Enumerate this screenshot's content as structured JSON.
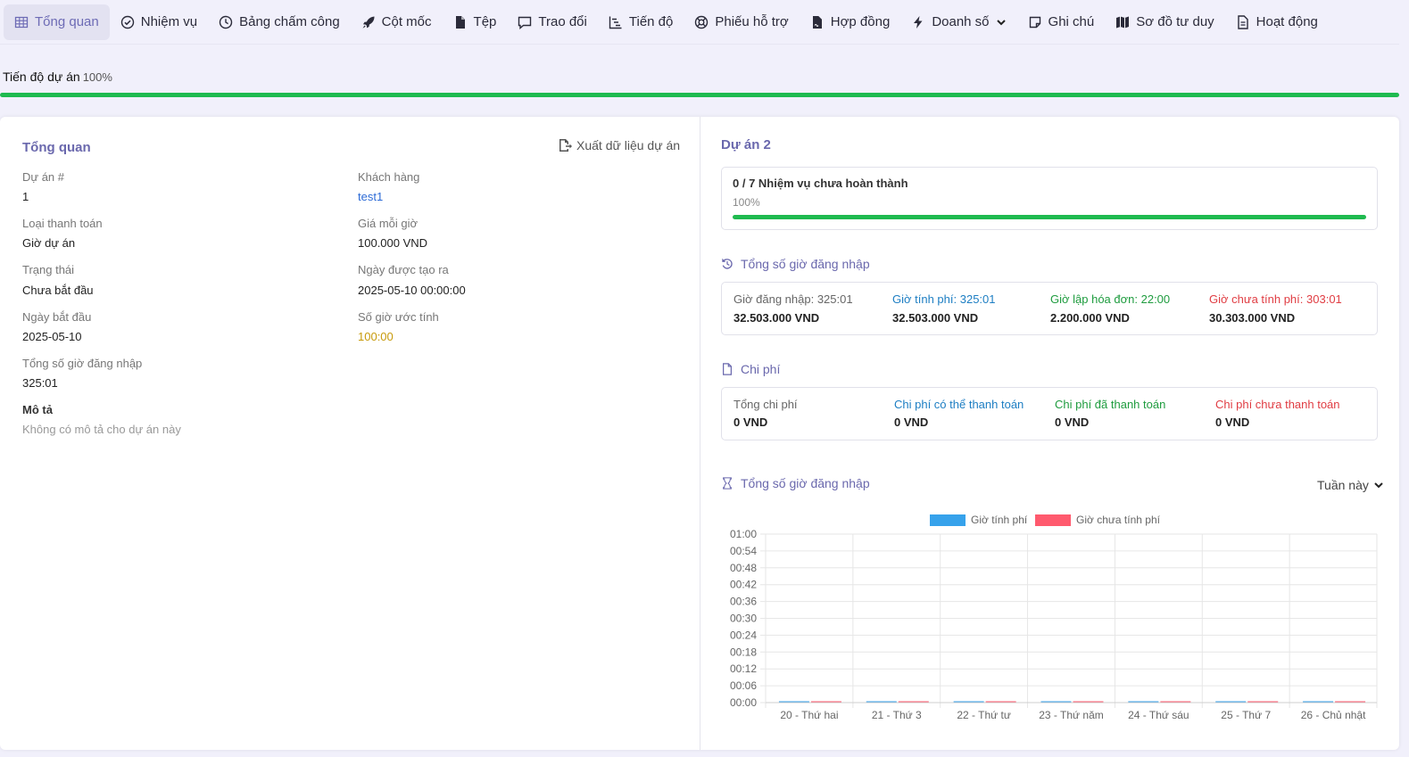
{
  "tabs": [
    {
      "label": "Tổng quan",
      "icon": "grid-icon",
      "active": true
    },
    {
      "label": "Nhiệm vụ",
      "icon": "check-circle-icon"
    },
    {
      "label": "Bảng chấm công",
      "icon": "clock-icon"
    },
    {
      "label": "Cột mốc",
      "icon": "rocket-icon"
    },
    {
      "label": "Tệp",
      "icon": "file-icon"
    },
    {
      "label": "Trao đổi",
      "icon": "chat-icon"
    },
    {
      "label": "Tiến độ",
      "icon": "gantt-icon"
    },
    {
      "label": "Phiếu hỗ trợ",
      "icon": "lifebuoy-icon"
    },
    {
      "label": "Hợp đồng",
      "icon": "contract-icon"
    },
    {
      "label": "Doanh số",
      "icon": "bolt-icon",
      "dropdown": true
    },
    {
      "label": "Ghi chú",
      "icon": "note-icon"
    },
    {
      "label": "Sơ đồ tư duy",
      "icon": "map-icon"
    },
    {
      "label": "Hoạt động",
      "icon": "document-icon"
    }
  ],
  "progress": {
    "label": "Tiến độ dự án",
    "value": "100%",
    "fraction": 1.0,
    "color": "#1fba4f"
  },
  "overview": {
    "title": "Tổng quan",
    "export_label": "Xuất dữ liệu dự án",
    "project_no_label": "Dự án #",
    "project_no": "1",
    "customer_label": "Khách hàng",
    "customer": "test1",
    "billing_type_label": "Loại thanh toán",
    "billing_type": "Giờ dự án",
    "rate_label": "Giá mỗi giờ",
    "rate": "100.000 VND",
    "status_label": "Trạng thái",
    "status": "Chưa bắt đầu",
    "created_label": "Ngày được tạo ra",
    "created": "2025-05-10 00:00:00",
    "start_label": "Ngày bắt đầu",
    "start": "2025-05-10",
    "estimate_label": "Số giờ ước tính",
    "estimate": "100:00",
    "logged_label": "Tổng số giờ đăng nhập",
    "logged": "325:01",
    "desc_label": "Mô tả",
    "desc": "Không có mô tả cho dự án này"
  },
  "right": {
    "title": "Dự án 2",
    "tasks_text": "0 / 7 Nhiệm vụ chưa hoàn thành",
    "tasks_pct": "100%",
    "tasks_fraction": 1.0,
    "hours_heading": "Tổng số giờ đăng nhập",
    "hours": [
      {
        "label": "Giờ đăng nhập: ",
        "value": "325:01",
        "amount": "32.503.000 VND",
        "color": "grey"
      },
      {
        "label": "Giờ tính phí: ",
        "value": "325:01",
        "amount": "32.503.000 VND",
        "color": "blue"
      },
      {
        "label": "Giờ lập hóa đơn: ",
        "value": "22:00",
        "amount": "2.200.000 VND",
        "color": "green"
      },
      {
        "label": "Giờ chưa tính phí: ",
        "value": "303:01",
        "amount": "30.303.000 VND",
        "color": "red"
      }
    ],
    "expense_heading": "Chi phí",
    "expenses": [
      {
        "label": "Tổng chi phí",
        "amount": "0 VND",
        "color": "grey"
      },
      {
        "label": "Chi phí có thể thanh toán",
        "amount": "0 VND",
        "color": "blue"
      },
      {
        "label": "Chi phí đã thanh toán",
        "amount": "0 VND",
        "color": "green"
      },
      {
        "label": "Chi phí chưa thanh toán",
        "amount": "0 VND",
        "color": "red"
      }
    ],
    "chart_heading": "Tổng số giờ đăng nhập",
    "period": "Tuần này"
  },
  "chart_data": {
    "type": "bar",
    "categories": [
      "20 - Thứ hai",
      "21 - Thứ 3",
      "22 - Thứ tư",
      "23 - Thứ năm",
      "24 - Thứ sáu",
      "25 - Thứ 7",
      "26 - Chủ nhật"
    ],
    "series": [
      {
        "name": "Giờ tính phí",
        "color": "#36a2eb",
        "values": [
          0,
          0,
          0,
          0,
          0,
          0,
          0
        ]
      },
      {
        "name": "Giờ chưa tính phí",
        "color": "#ff5a6e",
        "values": [
          0,
          0,
          0,
          0,
          0,
          0,
          0
        ]
      }
    ],
    "ylim": [
      0,
      1
    ],
    "yticks": [
      "00:00",
      "00:06",
      "00:12",
      "00:18",
      "00:24",
      "00:30",
      "00:36",
      "00:42",
      "00:48",
      "00:54",
      "01:00"
    ],
    "legend": "top",
    "grid": true
  }
}
